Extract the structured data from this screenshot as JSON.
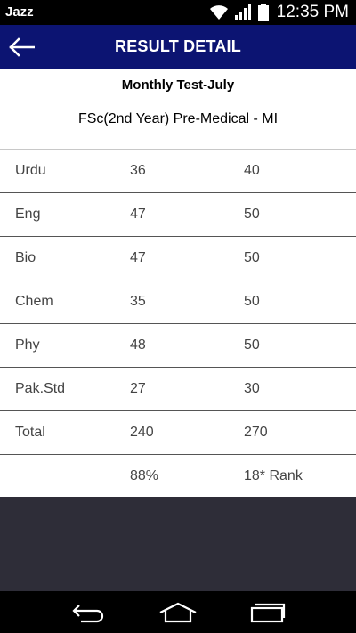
{
  "status_bar": {
    "carrier": "Jazz",
    "time": "12:35 PM",
    "icons": [
      "wifi-icon",
      "signal-icon",
      "battery-icon"
    ]
  },
  "app_bar": {
    "title": "RESULT DETAIL",
    "back_icon": "arrow-left-icon",
    "color": "#0c1472"
  },
  "result": {
    "test_name": "Monthly Test-July",
    "program": "FSc(2nd Year) Pre-Medical - MI",
    "rows": [
      {
        "subject": "Urdu",
        "obtained": "36",
        "total": "40"
      },
      {
        "subject": "Eng",
        "obtained": "47",
        "total": "50"
      },
      {
        "subject": "Bio",
        "obtained": "47",
        "total": "50"
      },
      {
        "subject": "Chem",
        "obtained": "35",
        "total": "50"
      },
      {
        "subject": "Phy",
        "obtained": "48",
        "total": "50"
      },
      {
        "subject": "Pak.Std",
        "obtained": "27",
        "total": "30"
      },
      {
        "subject": "Total",
        "obtained": "240",
        "total": "270"
      },
      {
        "subject": "",
        "obtained": "88%",
        "total": "18* Rank"
      }
    ]
  },
  "nav_bar": {
    "icons": [
      "back-icon",
      "home-icon",
      "recent-apps-icon"
    ]
  }
}
